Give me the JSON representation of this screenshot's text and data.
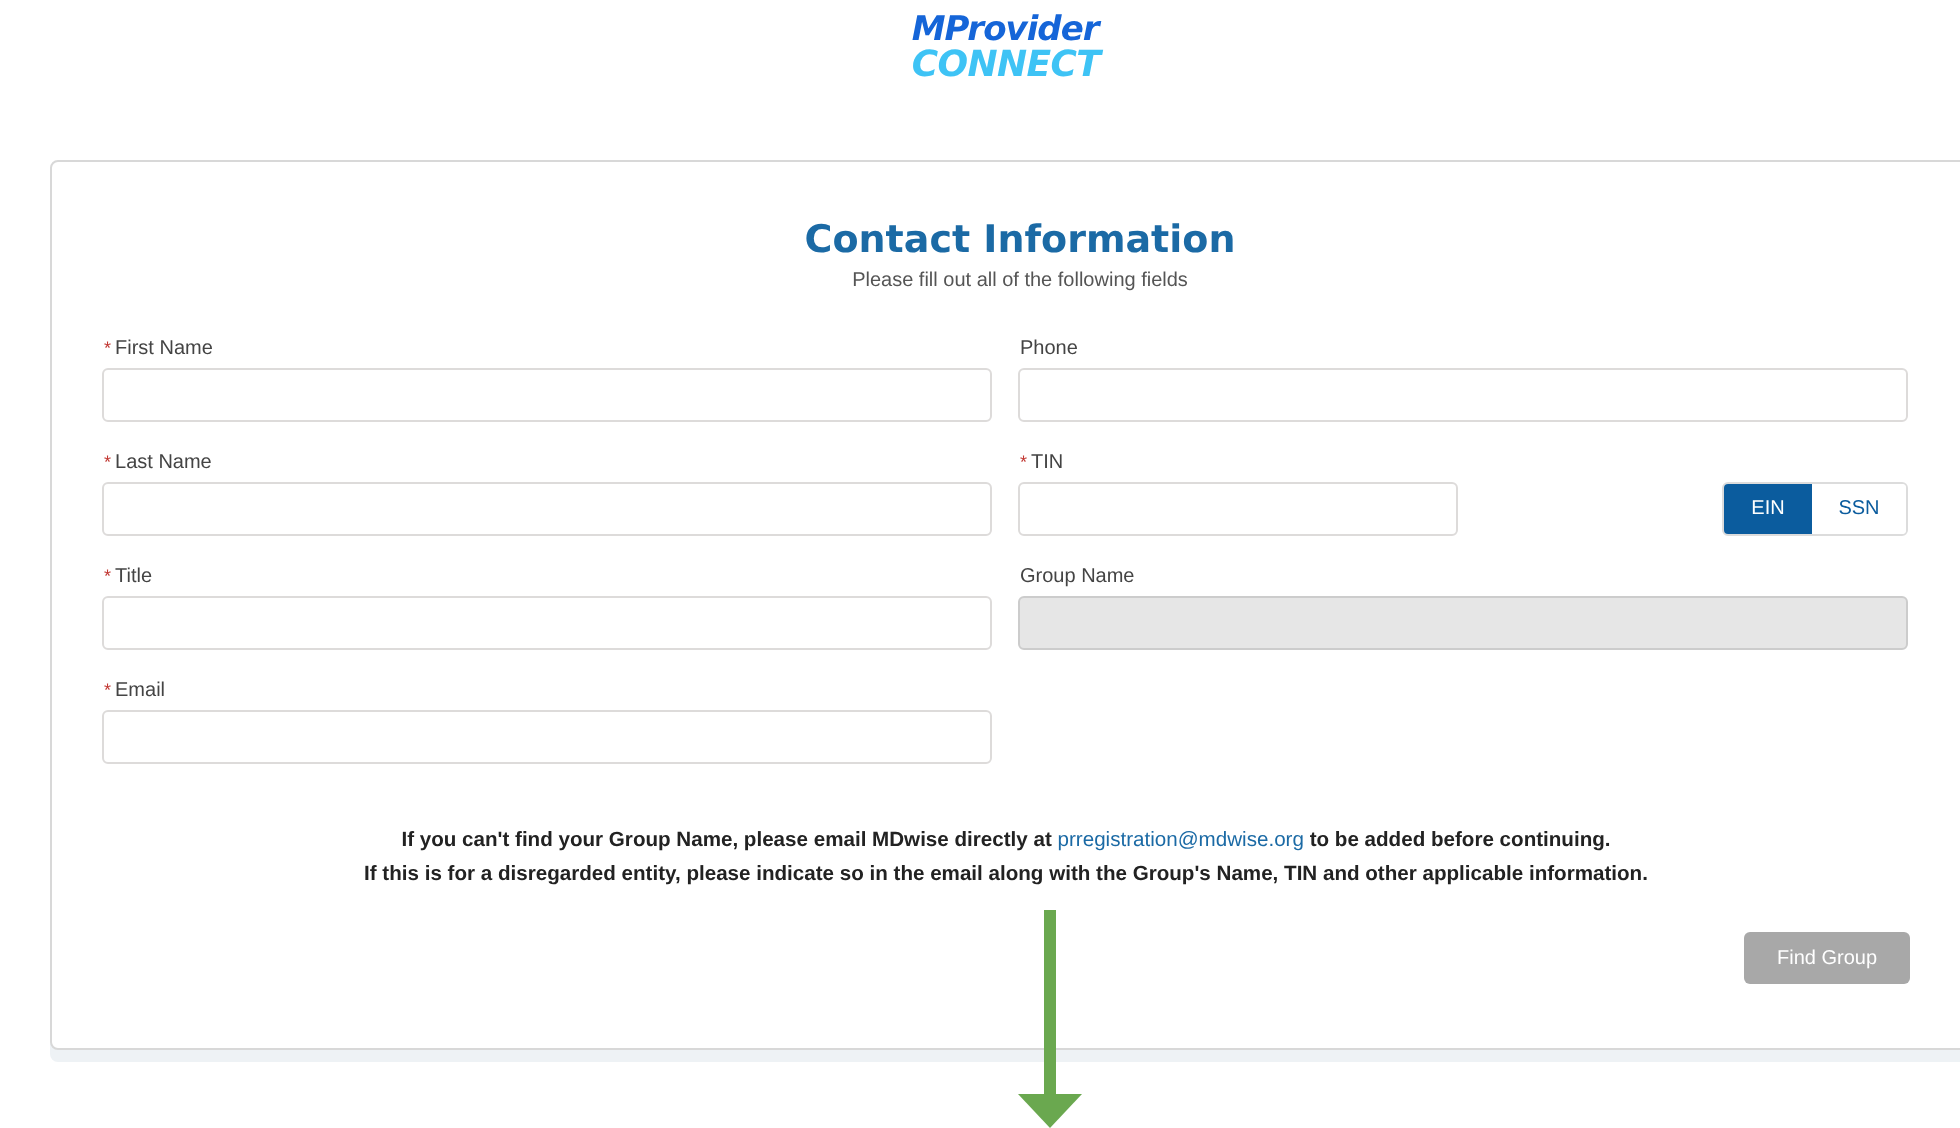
{
  "logo": {
    "line_1": "MProvider",
    "line_2": "CONNECT"
  },
  "form": {
    "title": "Contact Information",
    "subtitle": "Please fill out all of the following fields",
    "required_mark": "*",
    "left_fields": [
      {
        "kind": "text",
        "label": "First Name",
        "required": true,
        "disabled": false
      },
      {
        "kind": "text",
        "label": "Last Name",
        "required": true,
        "disabled": false
      },
      {
        "kind": "text",
        "label": "Title",
        "required": true,
        "disabled": false
      },
      {
        "kind": "text",
        "label": "Email",
        "required": true,
        "disabled": false
      }
    ],
    "right_fields": [
      {
        "kind": "text",
        "label": "Phone",
        "required": false,
        "disabled": false
      },
      {
        "kind": "tin",
        "label": "TIN",
        "required": true,
        "disabled": false,
        "options": [
          {
            "label": "EIN",
            "selected": true
          },
          {
            "label": "SSN",
            "selected": false
          }
        ]
      },
      {
        "kind": "text",
        "label": "Group Name",
        "required": false,
        "disabled": true
      }
    ],
    "notice": [
      {
        "before": "If you can't find your Group Name, please email MDwise directly at",
        "link": "prregistration@mdwise.org",
        "after": "to be added before continuing."
      },
      {
        "before": "If this is for a disregarded entity, please indicate so in the email along with the Group's Name, TIN and other applicable information."
      }
    ],
    "find_button": {
      "label": "Find Group",
      "disabled": true
    }
  }
}
